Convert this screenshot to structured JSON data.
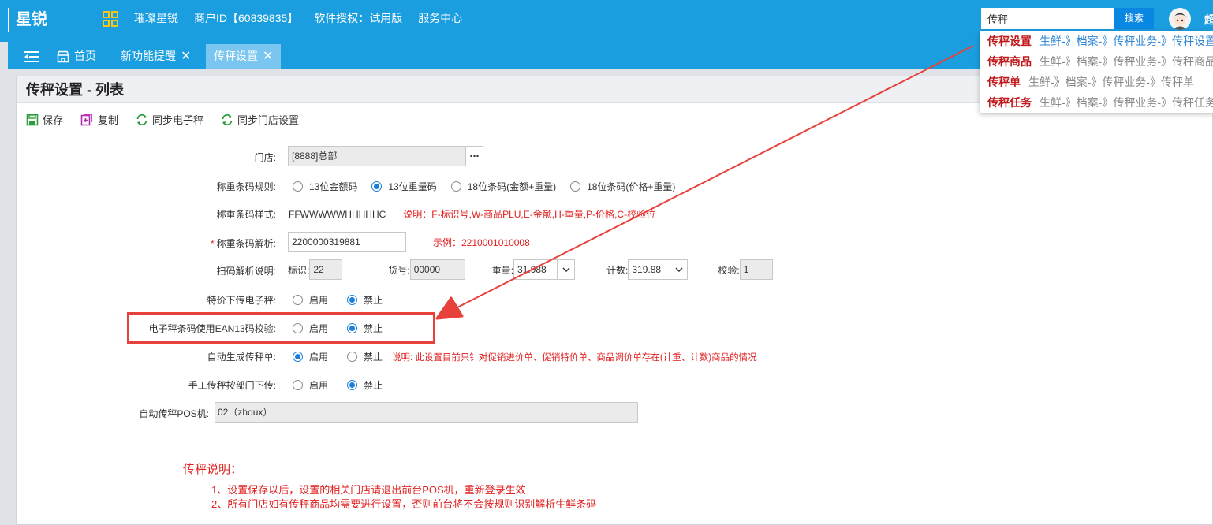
{
  "app": {
    "logo": "星锐",
    "nav": [
      "璀璨星锐",
      "商户ID【60839835】",
      "软件授权：试用版",
      "服务中心"
    ],
    "search_value": "传秤",
    "search_btn": "搜索",
    "user_initial": "超"
  },
  "tabs": [
    {
      "label": "首页"
    },
    {
      "label": "新功能提醒"
    },
    {
      "label": "传秤设置"
    }
  ],
  "page": {
    "title": "传秤设置 - 列表"
  },
  "toolbar": {
    "save": "保存",
    "copy": "复制",
    "sync_scale": "同步电子秤",
    "sync_store": "同步门店设置"
  },
  "form": {
    "store": {
      "label": "门店:",
      "value": "[8888]总部"
    },
    "rule": {
      "label": "称重条码规则:",
      "options": [
        "13位金额码",
        "13位重量码",
        "18位条码(金额+重量)",
        "18位条码(价格+重量)"
      ],
      "selected": 1
    },
    "style": {
      "label": "称重条码样式:",
      "value": "FFWWWWWHHHHHC",
      "note": "说明：F-标识号,W-商品PLU,E-金额,H-重量,P-价格,C-校验位"
    },
    "parse": {
      "label": "称重条码解析:",
      "value": "2200000319881",
      "example": "示例：2210001010008"
    },
    "scan": {
      "label": "扫码解析说明:",
      "flag_label": "标识:",
      "flag": "22",
      "code_label": "货号:",
      "code": "00000",
      "weight_label": "重量:",
      "weight": "31.988",
      "count_label": "计数:",
      "count": "319.88",
      "check_label": "校验:",
      "check": "1"
    },
    "special": {
      "label": "特价下传电子秤:",
      "options": [
        "启用",
        "禁止"
      ],
      "selected": 1
    },
    "ean13": {
      "label": "电子秤条码使用EAN13码校验:",
      "options": [
        "启用",
        "禁止"
      ],
      "selected": 1
    },
    "auto_gen": {
      "label": "自动生成传秤单:",
      "options": [
        "启用",
        "禁止"
      ],
      "selected": 0,
      "note": "说明: 此设置目前只针对促销进价单、促销特价单、商品调价单存在(计重、计数)商品的情况"
    },
    "manual": {
      "label": "手工传秤按部门下传:",
      "options": [
        "启用",
        "禁止"
      ],
      "selected": 1
    },
    "pos": {
      "label": "自动传秤POS机:",
      "value": "02（zhoux）"
    }
  },
  "notes": {
    "title": "传秤说明：",
    "lines": [
      "1、设置保存以后，设置的相关门店请退出前台POS机，重新登录生效",
      "2、所有门店如有传秤商品均需要进行设置，否则前台将不会按规则识别解析生鲜条码"
    ]
  },
  "dropdown": [
    {
      "key": "传秤设置",
      "path": "生鲜-》档案-》传秤业务-》",
      "tail": "传秤设置",
      "tail_link": true
    },
    {
      "key": "传秤商品",
      "path": "生鲜-》档案-》传秤业务-》",
      "tail": "传秤商品",
      "tail_link": false
    },
    {
      "key": "传秤单",
      "path": "生鲜-》档案-》传秤业务-》",
      "tail": "传秤单",
      "tail_link": false
    },
    {
      "key": "传秤任务",
      "path": "生鲜-》档案-》传秤业务-》",
      "tail": "传秤任务",
      "tail_link": false
    }
  ],
  "colors": {
    "header": "#1b9ee0",
    "active_tab": "#7ac6f0",
    "annotation": "#e8413c",
    "note_red": "#e02020"
  }
}
